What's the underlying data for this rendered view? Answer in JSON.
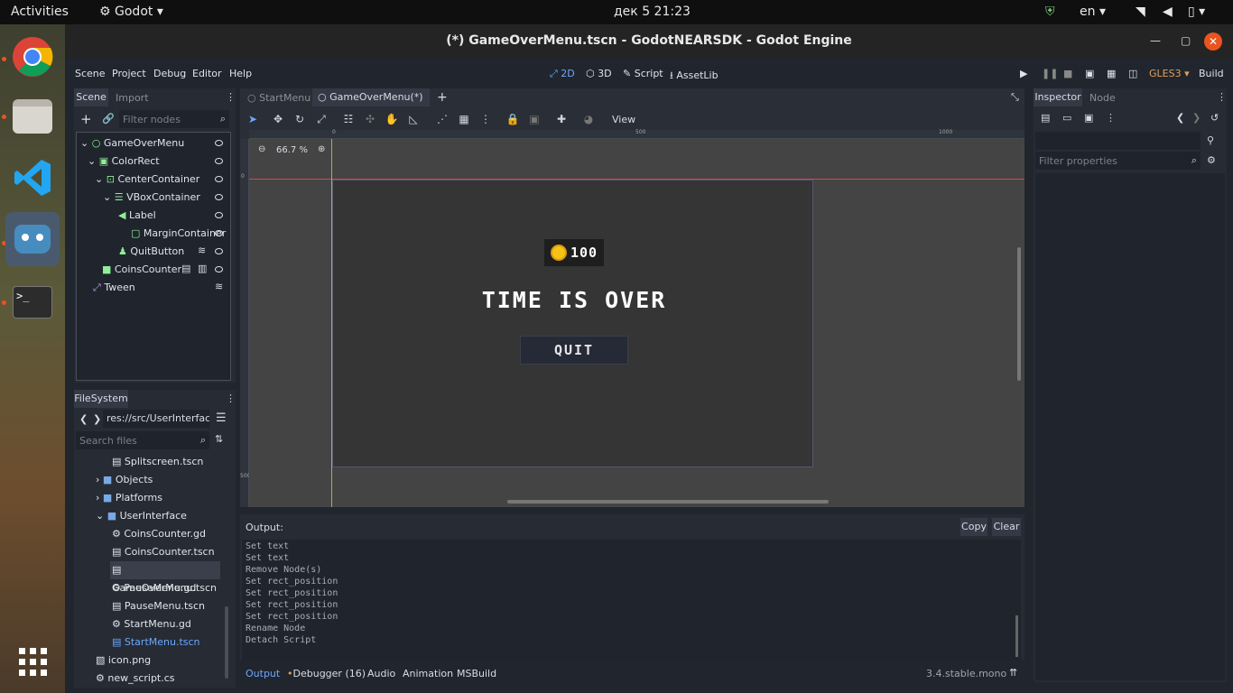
{
  "topbar": {
    "activities": "Activities",
    "app": "Godot",
    "datetime": "дек 5  21:23",
    "lang": "en"
  },
  "window": {
    "title": "(*) GameOverMenu.tscn - GodotNEARSDK - Godot Engine"
  },
  "menu": {
    "scene": "Scene",
    "project": "Project",
    "debug": "Debug",
    "editor": "Editor",
    "help": "Help"
  },
  "workspaces": {
    "2d": "2D",
    "3d": "3D",
    "script": "Script",
    "assetlib": "AssetLib"
  },
  "right_menu": {
    "renderer": "GLES3",
    "build": "Build"
  },
  "scene_dock": {
    "tab_scene": "Scene",
    "tab_import": "Import",
    "filter_placeholder": "Filter nodes",
    "nodes": [
      {
        "label": "GameOverMenu"
      },
      {
        "label": "ColorRect"
      },
      {
        "label": "CenterContainer"
      },
      {
        "label": "VBoxContainer"
      },
      {
        "label": "Label"
      },
      {
        "label": "MarginContainer"
      },
      {
        "label": "QuitButton"
      },
      {
        "label": "CoinsCounter"
      },
      {
        "label": "Tween"
      }
    ]
  },
  "filesystem": {
    "tab": "FileSystem",
    "path": "res://src/UserInterface",
    "search_placeholder": "Search files",
    "items": [
      {
        "label": "Splitscreen.tscn"
      },
      {
        "label": "Objects"
      },
      {
        "label": "Platforms"
      },
      {
        "label": "UserInterface"
      },
      {
        "label": "CoinsCounter.gd"
      },
      {
        "label": "CoinsCounter.tscn"
      },
      {
        "label": "GameOverMenu.tscn"
      },
      {
        "label": "PauseMenu.gd"
      },
      {
        "label": "PauseMenu.tscn"
      },
      {
        "label": "StartMenu.gd"
      },
      {
        "label": "StartMenu.tscn"
      },
      {
        "label": "icon.png"
      },
      {
        "label": "new_script.cs"
      }
    ]
  },
  "editor_tabs": {
    "tab1": "StartMenu",
    "tab2": "GameOverMenu(*)"
  },
  "toolbar": {
    "view": "View"
  },
  "viewport": {
    "zoom": "66.7 %",
    "ruler_500": "500",
    "ruler_1000": "1000",
    "ruler_v0": "0",
    "ruler_v500": "500",
    "coins": "100",
    "title": "TIME IS OVER",
    "quit": "QUIT"
  },
  "output": {
    "label": "Output:",
    "copy": "Copy",
    "clear": "Clear",
    "lines": [
      "Set text",
      "Set text",
      "Remove Node(s)",
      "Set rect_position",
      "Set rect_position",
      "Set rect_position",
      "Set rect_position",
      "Rename Node",
      "Detach Script"
    ]
  },
  "bottom_tabs": {
    "output": "Output",
    "debugger": "Debugger (16)",
    "audio": "Audio",
    "animation": "Animation",
    "msbuild": "MSBuild",
    "version": "3.4.stable.mono"
  },
  "inspector": {
    "tab_inspector": "Inspector",
    "tab_node": "Node",
    "filter_placeholder": "Filter properties"
  },
  "colors": {
    "accent": "#6aa8ff",
    "node_green": "#8eef97",
    "panel": "#272b33",
    "bg": "#21252d"
  }
}
